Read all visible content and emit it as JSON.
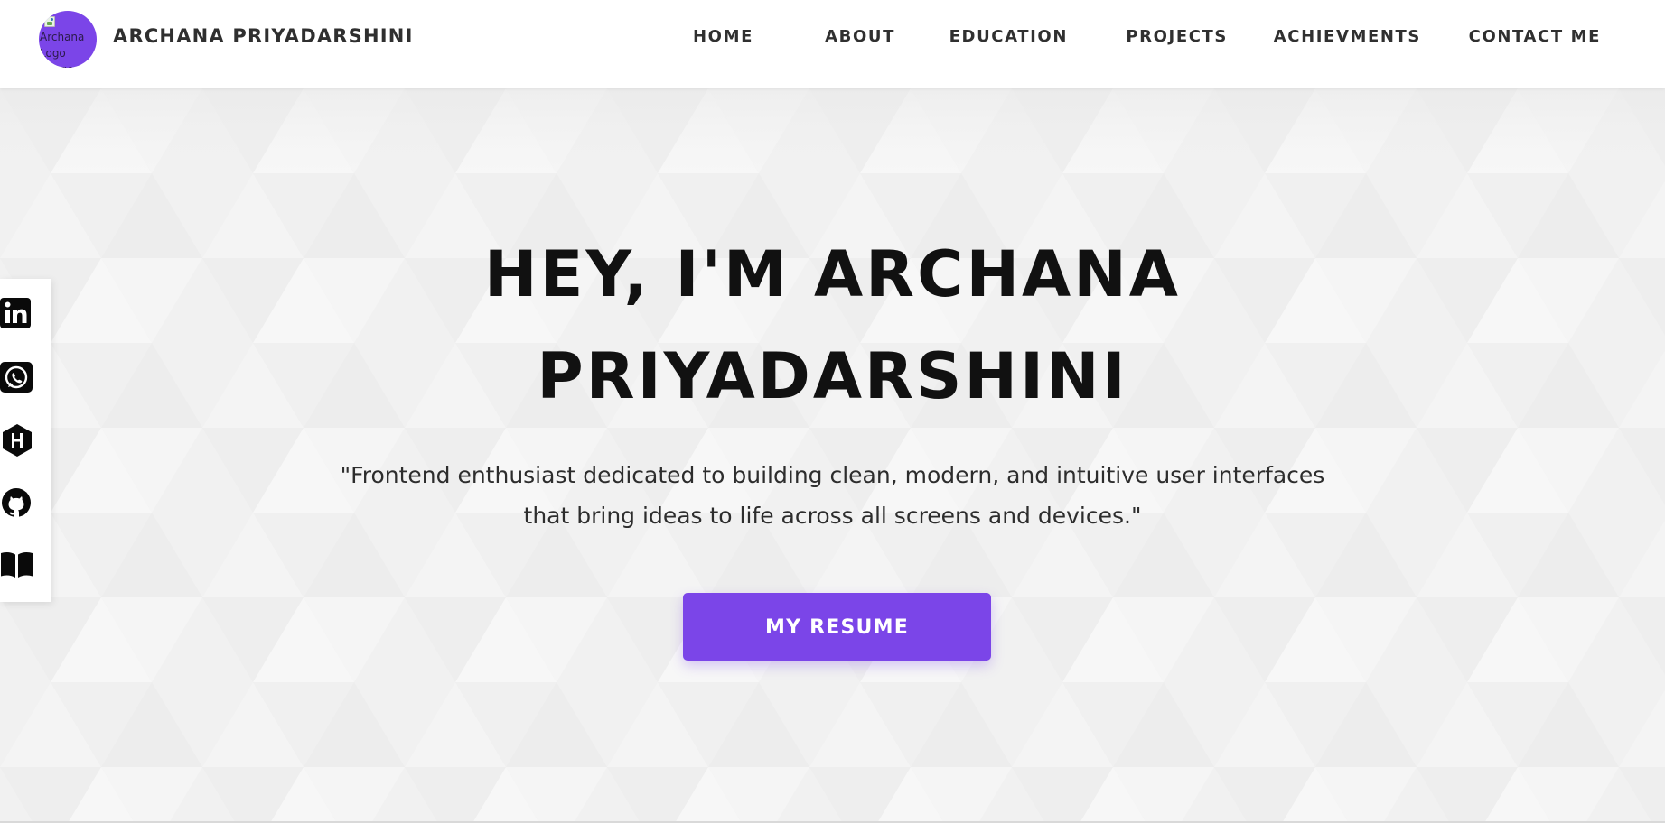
{
  "header": {
    "logo_alt": "Archana Logo Image",
    "brand_name": "ARCHANA PRIYADARSHINI",
    "nav": [
      {
        "label": "HOME"
      },
      {
        "label": "ABOUT"
      },
      {
        "label": "EDUCATION"
      },
      {
        "label": "PROJECTS"
      },
      {
        "label": "ACHIEVMENTS"
      },
      {
        "label": "CONTACT ME"
      }
    ]
  },
  "hero": {
    "title_line1": "HEY, I'M ARCHANA",
    "title_line2": "PRIYADARSHINI",
    "tagline_line1": "\"Frontend enthusiast dedicated to building clean, modern, and intuitive user interfaces",
    "tagline_line2": "that bring ideas to life across all screens and devices.\"",
    "resume_label": "MY RESUME"
  },
  "social": [
    {
      "icon": "linkedin-icon"
    },
    {
      "icon": "whatsapp-icon"
    },
    {
      "icon": "hashnode-icon"
    },
    {
      "icon": "github-icon"
    },
    {
      "icon": "book-icon"
    }
  ],
  "colors": {
    "accent": "#7b45e8",
    "header_bg": "#ffffff",
    "hero_bg": "#f2f2f2",
    "heading": "#111111",
    "nav_text": "#303030"
  }
}
